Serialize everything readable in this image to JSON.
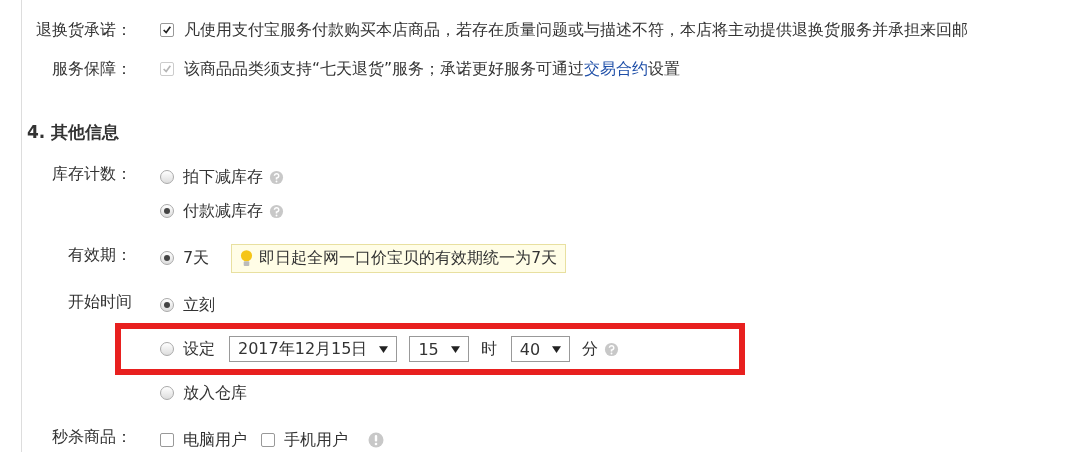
{
  "promises": [
    {
      "label": "退换货承诺：",
      "checked": true,
      "disabled": false,
      "parts": [
        {
          "text": "凡使用支付宝服务付款购买本店商品，若存在质量问题或与描述不符，本店将主动提供退换货服务并承担来回邮"
        }
      ]
    },
    {
      "label": "服务保障：",
      "checked": true,
      "disabled": true,
      "parts": [
        {
          "text": "该商品品类须支持“七天退货”服务；承诺更好服务可通过"
        },
        {
          "text": "交易合约",
          "link": true
        },
        {
          "text": "设置"
        }
      ]
    }
  ],
  "section": {
    "title": "4. 其他信息",
    "fields": [
      {
        "label": "库存计数：",
        "kind": "radios",
        "options": [
          {
            "label": "拍下减库存",
            "selected": false,
            "help": true
          },
          {
            "label": "付款减库存",
            "selected": true,
            "help": true
          }
        ]
      },
      {
        "label": "有效期：",
        "kind": "radios",
        "options": [
          {
            "label": "7天",
            "selected": true,
            "help": false,
            "tip": "即日起全网一口价宝贝的有效期统一为7天"
          }
        ]
      },
      {
        "label": "开始时间",
        "kind": "radios",
        "options": [
          {
            "label": "立刻",
            "selected": true,
            "help": false
          },
          {
            "label": "设定",
            "selected": false,
            "help": true,
            "date": "2017年12月15日",
            "hour": "15",
            "hour_unit": "时",
            "minute": "40",
            "minute_unit": "分"
          },
          {
            "label": "放入仓库",
            "selected": false,
            "help": false
          }
        ]
      },
      {
        "label": "秒杀商品：",
        "kind": "checkboxes",
        "options": [
          {
            "label": "电脑用户",
            "checked": false
          },
          {
            "label": "手机用户",
            "checked": false
          }
        ],
        "info": true
      }
    ]
  },
  "annotation": {
    "kind": "rectangle"
  }
}
